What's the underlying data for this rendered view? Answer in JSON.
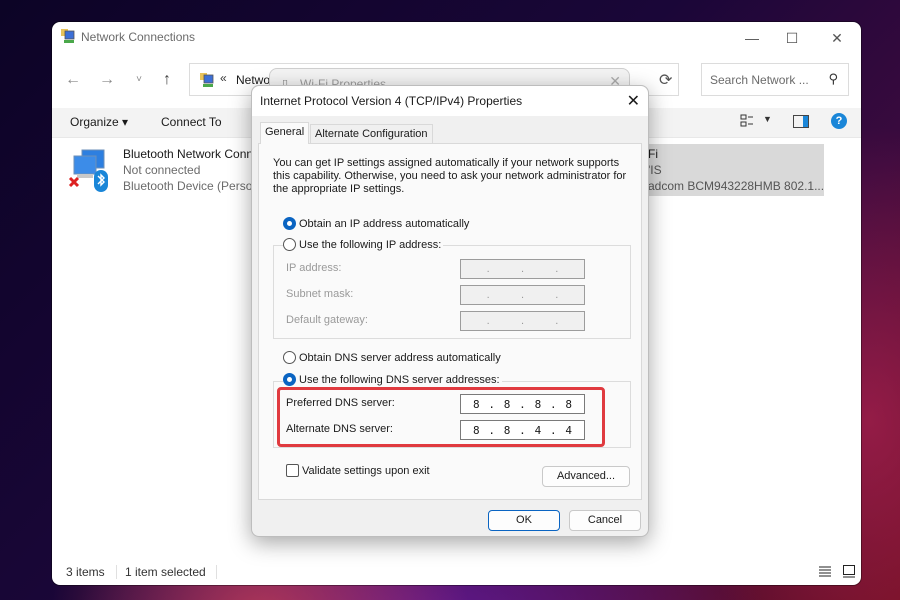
{
  "explorer": {
    "title": "Network Connections",
    "nav": {
      "back": "←",
      "forward": "→",
      "recent": "˅",
      "up": "↑",
      "refresh": "⟳"
    },
    "address": {
      "chevron": "«",
      "text": "Netwo"
    },
    "search": {
      "placeholder": "Search Network ...",
      "icon": "⚲"
    },
    "window_controls": {
      "minimize": "—",
      "maximize": "☐",
      "close": "✕"
    },
    "commands": {
      "organize": "Organize ▾",
      "connect_to": "Connect To",
      "view_dropdown": "▼",
      "help": "?"
    },
    "connections": [
      {
        "name": "Bluetooth Network Conn",
        "status": "Not connected",
        "device": "Bluetooth Device (Person"
      },
      {
        "name": "Fi",
        "status": "'IS",
        "device": "adcom BCM943228HMB 802.1..."
      }
    ],
    "status": {
      "count": "3 items",
      "selected": "1 item selected"
    }
  },
  "wifi_properties": {
    "title": "Wi-Fi Properties",
    "close": "✕"
  },
  "dialog": {
    "title": "Internet Protocol Version 4 (TCP/IPv4) Properties",
    "close": "✕",
    "tabs": [
      {
        "label": "General",
        "active": true
      },
      {
        "label": "Alternate Configuration",
        "active": false
      }
    ],
    "intro": "You can get IP settings assigned automatically if your network supports this capability. Otherwise, you need to ask your network administrator for the appropriate IP settings.",
    "ip_mode": {
      "auto_label": "Obtain an IP address automatically",
      "manual_label": "Use the following IP address:",
      "selected": "auto"
    },
    "ip_fields": [
      {
        "label": "IP address:",
        "value": ". . ."
      },
      {
        "label": "Subnet mask:",
        "value": ". . ."
      },
      {
        "label": "Default gateway:",
        "value": ". . ."
      }
    ],
    "dns_mode": {
      "auto_label": "Obtain DNS server address automatically",
      "manual_label": "Use the following DNS server addresses:",
      "selected": "manual"
    },
    "dns_fields": [
      {
        "label": "Preferred DNS server:",
        "octets": [
          "8",
          ".",
          "8",
          ".",
          "8",
          ".",
          "8"
        ]
      },
      {
        "label": "Alternate DNS server:",
        "octets": [
          "8",
          ".",
          "8",
          ".",
          "4",
          ".",
          "4"
        ]
      }
    ],
    "highlight_color": "#e03a3f",
    "validate_label": "Validate settings upon exit",
    "validate_checked": false,
    "advanced_label": "Advanced...",
    "ok_label": "OK",
    "cancel_label": "Cancel"
  }
}
